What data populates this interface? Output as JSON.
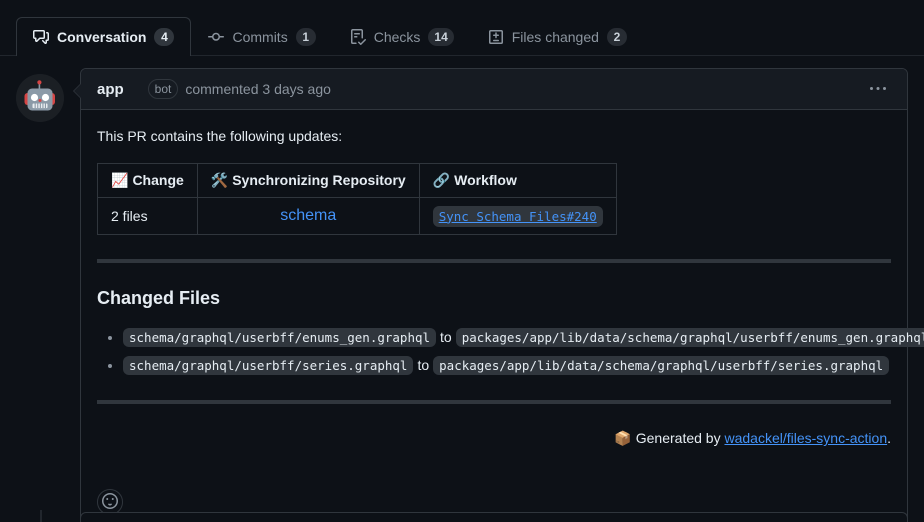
{
  "tabs": [
    {
      "id": "conversation",
      "label": "Conversation",
      "count": "4",
      "icon": "comment-discussion-icon",
      "selected": true
    },
    {
      "id": "commits",
      "label": "Commits",
      "count": "1",
      "icon": "git-commit-icon",
      "selected": false
    },
    {
      "id": "checks",
      "label": "Checks",
      "count": "14",
      "icon": "checklist-icon",
      "selected": false
    },
    {
      "id": "files",
      "label": "Files changed",
      "count": "2",
      "icon": "file-diff-icon",
      "selected": false
    }
  ],
  "comment": {
    "avatar_icon": "robot-avatar",
    "author": "app",
    "bot_label": "bot",
    "commented_text": "commented 3 days ago",
    "kebab_icon": "kebab-horizontal-icon",
    "intro": "This PR contains the following updates:",
    "table": {
      "headers": [
        {
          "emoji": "📈",
          "icon": "chart-increasing-emoji",
          "label": "Change"
        },
        {
          "emoji": "🛠️",
          "icon": "hammer-and-wrench-emoji",
          "label": "Synchronizing Repository"
        },
        {
          "emoji": "🔗",
          "icon": "link-emoji",
          "label": "Workflow"
        }
      ],
      "row": {
        "change": "2 files",
        "repository": "schema",
        "workflow": "Sync Schema Files#240"
      }
    },
    "changed_files_heading": "Changed Files",
    "changed_files": [
      {
        "from": "schema/graphql/userbff/enums_gen.graphql",
        "to_word": "to",
        "to": "packages/app/lib/data/schema/graphql/userbff/enums_gen.graphql"
      },
      {
        "from": "schema/graphql/userbff/series.graphql",
        "to_word": "to",
        "to": "packages/app/lib/data/schema/graphql/userbff/series.graphql"
      }
    ],
    "generated": {
      "emoji": "📦",
      "icon": "package-emoji",
      "prefix": "Generated by ",
      "link": "wadackel/files-sync-action",
      "suffix": "."
    },
    "reaction_button_icon": "smiley-icon"
  },
  "colors": {
    "page_bg": "#0d1117",
    "header_bg": "#161b22",
    "border": "#30363d",
    "link": "#4493f8",
    "text": "#e6edf3",
    "muted": "#8b949e"
  }
}
